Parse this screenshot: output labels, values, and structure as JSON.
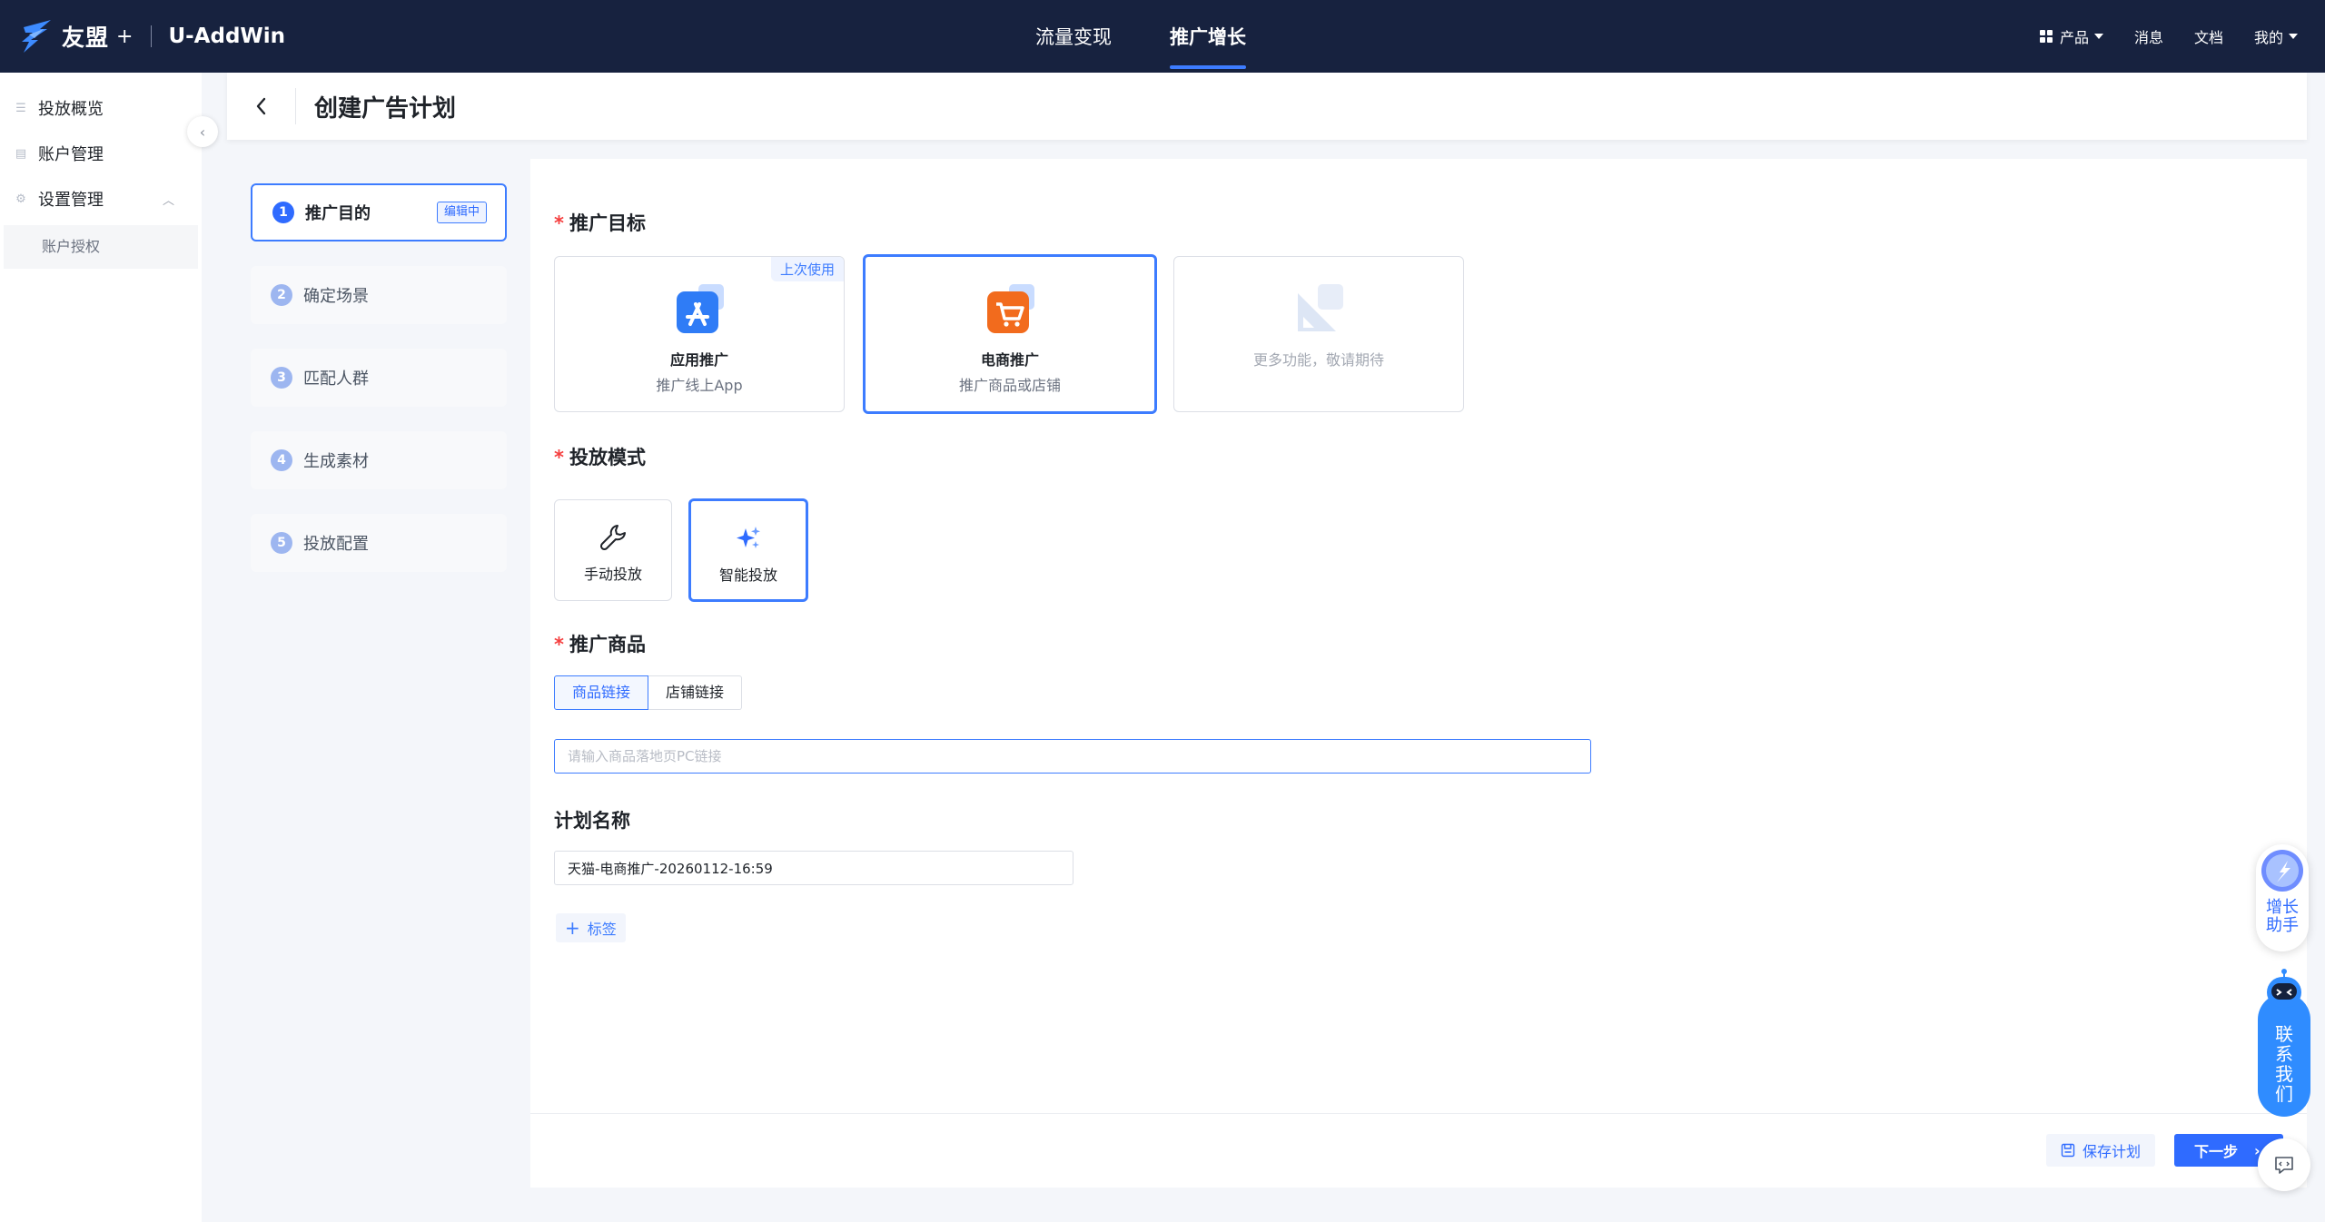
{
  "topbar": {
    "logo_text": "友盟",
    "logo_plus": "+",
    "app_name": "U-AddWin",
    "nav": [
      {
        "label": "流量变现",
        "active": false
      },
      {
        "label": "推广增长",
        "active": true
      }
    ],
    "right": {
      "product": "产品",
      "messages": "消息",
      "docs": "文档",
      "mine": "我的"
    }
  },
  "sidebar": {
    "items": [
      {
        "label": "投放概览",
        "icon": "list-icon"
      },
      {
        "label": "账户管理",
        "icon": "account-icon"
      },
      {
        "label": "设置管理",
        "icon": "settings-icon",
        "expanded": true
      }
    ],
    "sub_items": [
      {
        "label": "账户授权"
      }
    ]
  },
  "header": {
    "title": "创建广告计划"
  },
  "steps": [
    {
      "num": "1",
      "label": "推广目的",
      "badge": "编辑中",
      "active": true
    },
    {
      "num": "2",
      "label": "确定场景"
    },
    {
      "num": "3",
      "label": "匹配人群"
    },
    {
      "num": "4",
      "label": "生成素材"
    },
    {
      "num": "5",
      "label": "投放配置"
    }
  ],
  "form": {
    "target": {
      "title": "推广目标",
      "required": "*",
      "cards": [
        {
          "title": "应用推广",
          "sub": "推广线上App",
          "tag": "上次使用",
          "icon": "app-store-icon"
        },
        {
          "title": "电商推广",
          "sub": "推广商品或店铺",
          "icon": "shopping-cart-icon",
          "selected": true
        },
        {
          "title": "更多功能，敬请期待",
          "icon": "more-features-icon",
          "disabled": true
        }
      ]
    },
    "mode": {
      "title": "投放模式",
      "required": "*",
      "options": [
        {
          "label": "手动投放",
          "icon": "wrench-icon"
        },
        {
          "label": "智能投放",
          "icon": "sparkle-icon",
          "selected": true
        }
      ]
    },
    "product": {
      "title": "推广商品",
      "required": "*",
      "tabs": [
        {
          "label": "商品链接",
          "active": true
        },
        {
          "label": "店铺链接",
          "active": false
        }
      ],
      "input_placeholder": "请输入商品落地页PC链接",
      "input_value": ""
    },
    "plan_name": {
      "title": "计划名称",
      "value": "天猫-电商推广-20260112-16:59"
    },
    "tag_button": "标签"
  },
  "footer": {
    "save_label": "保存计划",
    "next_label": "下一步"
  },
  "floating": {
    "growth_assistant": "增长助手",
    "contact_us": [
      "联",
      "系",
      "我",
      "们"
    ]
  },
  "colors": {
    "topbar_bg": "#17223f",
    "primary": "#2f6bff",
    "required": "#f53f3f"
  }
}
